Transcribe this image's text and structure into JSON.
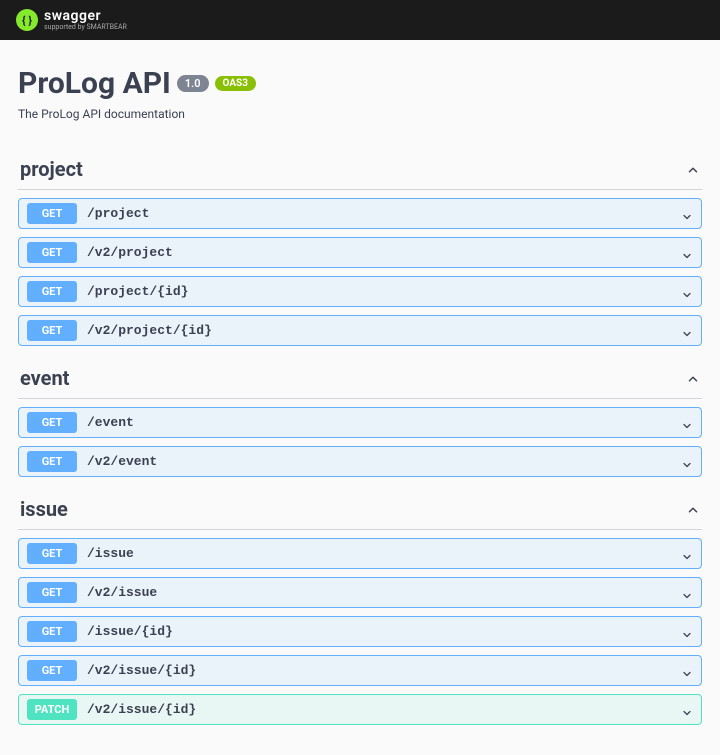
{
  "topbar": {
    "brand_name": "swagger",
    "supported_text": "supported by SMARTBEAR"
  },
  "api": {
    "title": "ProLog API",
    "version": "1.0",
    "oas_label": "OAS3",
    "description": "The ProLog API documentation"
  },
  "tags": [
    {
      "name": "project",
      "operations": [
        {
          "method": "GET",
          "path": "/project"
        },
        {
          "method": "GET",
          "path": "/v2/project"
        },
        {
          "method": "GET",
          "path": "/project/{id}"
        },
        {
          "method": "GET",
          "path": "/v2/project/{id}"
        }
      ]
    },
    {
      "name": "event",
      "operations": [
        {
          "method": "GET",
          "path": "/event"
        },
        {
          "method": "GET",
          "path": "/v2/event"
        }
      ]
    },
    {
      "name": "issue",
      "operations": [
        {
          "method": "GET",
          "path": "/issue"
        },
        {
          "method": "GET",
          "path": "/v2/issue"
        },
        {
          "method": "GET",
          "path": "/issue/{id}"
        },
        {
          "method": "GET",
          "path": "/v2/issue/{id}"
        },
        {
          "method": "PATCH",
          "path": "/v2/issue/{id}"
        }
      ]
    }
  ]
}
